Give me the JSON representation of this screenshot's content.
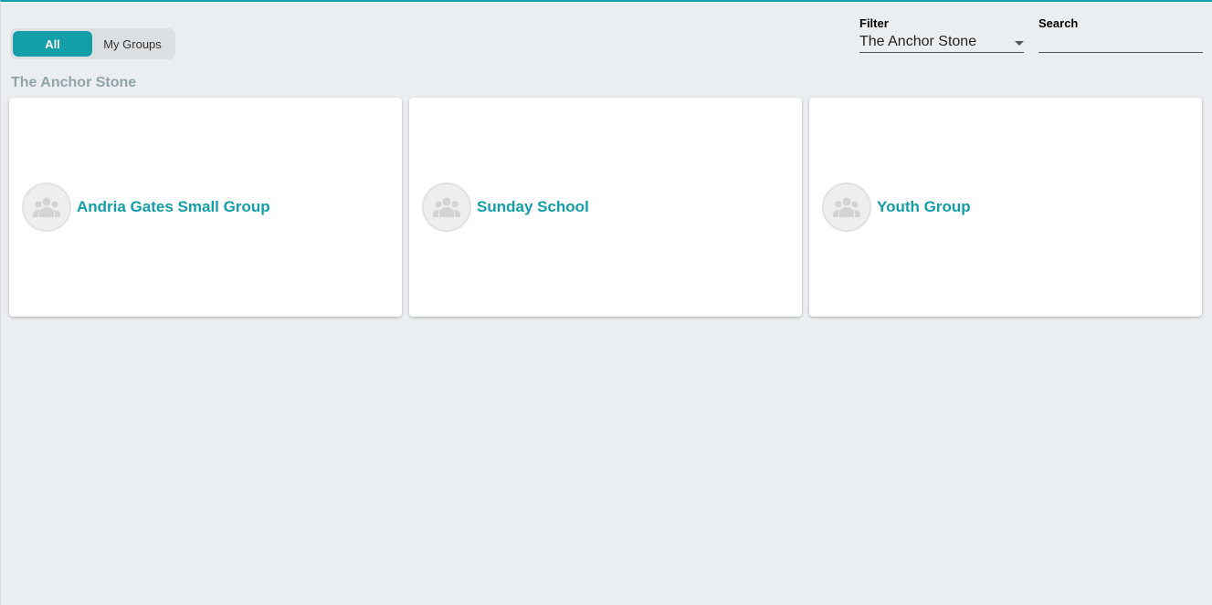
{
  "toggle": {
    "all": "All",
    "my_groups": "My Groups"
  },
  "filter": {
    "label": "Filter",
    "value": "The Anchor Stone"
  },
  "search": {
    "label": "Search",
    "value": ""
  },
  "section_title": "The Anchor Stone",
  "groups": [
    {
      "name": "Andria Gates Small Group"
    },
    {
      "name": "Sunday School"
    },
    {
      "name": "Youth Group"
    }
  ]
}
